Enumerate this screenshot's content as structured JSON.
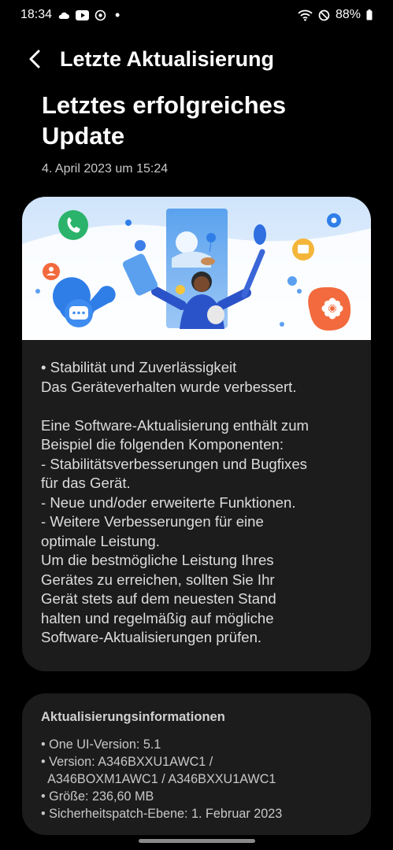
{
  "status_bar": {
    "time": "18:34",
    "battery": "88%"
  },
  "app_bar": {
    "title": "Letzte Aktualisierung"
  },
  "header": {
    "title": "Letztes erfolgreiches Update",
    "date": "4. April 2023 um 15:24"
  },
  "release_notes": {
    "lines": [
      "• Stabilität und Zuverlässigkeit",
      "Das Geräteverhalten wurde verbessert.",
      "",
      "Eine Software-Aktualisierung enthält zum",
      "Beispiel die folgenden Komponenten:",
      " - Stabilitätsverbesserungen und Bugfixes",
      "für das Gerät.",
      " - Neue und/oder erweiterte Funktionen.",
      " - Weitere Verbesserungen für eine",
      "optimale Leistung.",
      "Um die bestmögliche Leistung Ihres",
      "Gerätes zu erreichen, sollten Sie Ihr",
      "Gerät stets auf dem neuesten Stand",
      "halten und regelmäßig auf mögliche",
      "Software-Aktualisierungen prüfen."
    ]
  },
  "update_info": {
    "title": "Aktualisierungsinformationen",
    "lines": [
      "• One UI-Version: 5.1",
      "• Version: A346BXXU1AWC1 /",
      "  A346BOXM1AWC1 / A346BXXU1AWC1",
      "• Größe: 236,60 MB",
      "• Sicherheitspatch-Ebene: 1. Februar 2023"
    ]
  },
  "colors": {
    "background": "#000000",
    "card": "#1c1c1c",
    "accent_orange": "#f26a3d",
    "accent_blue": "#2f7ee8"
  }
}
